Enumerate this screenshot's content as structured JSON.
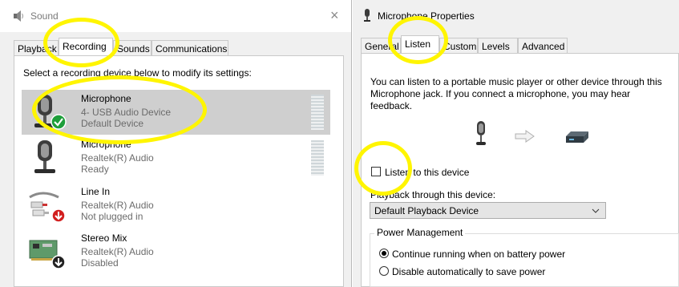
{
  "sound_window": {
    "title": "Sound",
    "close_glyph": "×",
    "tabs": [
      {
        "label": "Playback"
      },
      {
        "label": "Recording",
        "active": true
      },
      {
        "label": "Sounds"
      },
      {
        "label": "Communications"
      }
    ],
    "instruction": "Select a recording device below to modify its settings:",
    "devices": [
      {
        "name": "Microphone",
        "line1": "4- USB Audio Device",
        "line2": "Default Device",
        "selected": true,
        "status_icon": "green-check-icon"
      },
      {
        "name": "Microphone",
        "line1": "Realtek(R) Audio",
        "line2": "Ready",
        "selected": false
      },
      {
        "name": "Line In",
        "line1": "Realtek(R) Audio",
        "line2": "Not plugged in",
        "selected": false,
        "status_icon": "red-down-arrow-icon"
      },
      {
        "name": "Stereo Mix",
        "line1": "Realtek(R) Audio",
        "line2": "Disabled",
        "selected": false,
        "status_icon": "black-down-arrow-icon"
      }
    ]
  },
  "properties_window": {
    "title": "Microphone Properties",
    "tabs": [
      {
        "label": "General"
      },
      {
        "label": "Listen",
        "active": true
      },
      {
        "label": "Custom"
      },
      {
        "label": "Levels"
      },
      {
        "label": "Advanced"
      }
    ],
    "description": "You can listen to a portable music player or other device through this Microphone jack.  If you connect a microphone, you may hear feedback.",
    "listen_checkbox_label": "Listen to this device",
    "listen_checked": false,
    "playback_label": "Playback through this device:",
    "playback_value": "Default Playback Device",
    "power_group_label": "Power Management",
    "power_options": [
      {
        "label": "Continue running when on battery power",
        "checked": true
      },
      {
        "label": "Disable automatically to save power",
        "checked": false
      }
    ]
  },
  "colors": {
    "highlight_annotation": "#fff500",
    "selected_row": "#cfcfcf",
    "check_green": "#1e9e3a",
    "status_red": "#d21f1f"
  }
}
